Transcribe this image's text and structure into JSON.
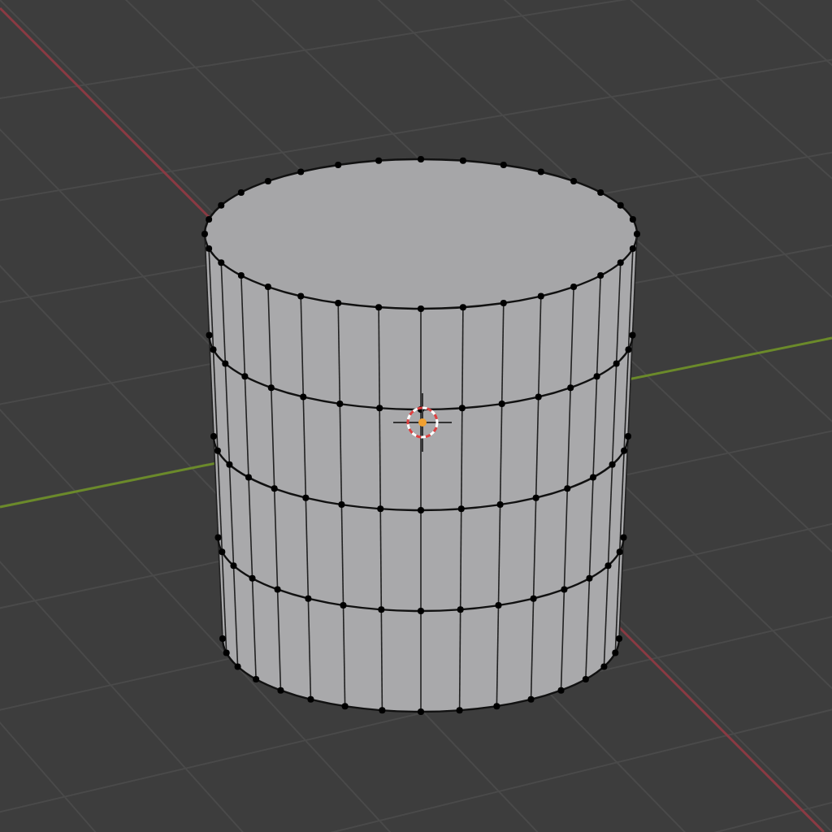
{
  "viewport": {
    "kind": "edit-mesh"
  }
}
